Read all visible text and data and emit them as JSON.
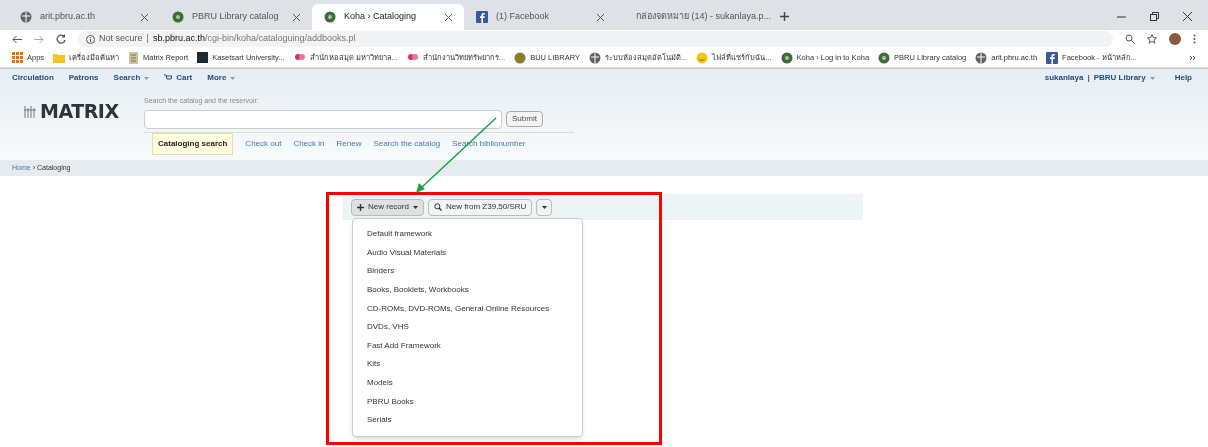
{
  "browser": {
    "tabs": [
      {
        "title": "arit.pbru.ac.th",
        "kind": "globe",
        "selected": false
      },
      {
        "title": "PBRU Library catalog",
        "kind": "koha",
        "selected": false
      },
      {
        "title": "Koha › Cataloging",
        "kind": "koha",
        "selected": true
      },
      {
        "title": "(1) Facebook",
        "kind": "facebook",
        "selected": false
      },
      {
        "title": "กล่องจดหมาย (14) - sukanlaya.p...",
        "kind": "gmail",
        "selected": false
      }
    ],
    "address": {
      "security": "Not secure",
      "separator": "|",
      "host": "sb.pbru.ac.th",
      "path": "/cgi-bin/koha/cataloguing/addbooks.pl"
    },
    "bookmarks": [
      {
        "label": "Apps",
        "kind": "apps"
      },
      {
        "label": "เครื่องมือค้นหา",
        "kind": "folder"
      },
      {
        "label": "Matrix Report",
        "kind": "doc"
      },
      {
        "label": "Kasetsart University...",
        "kind": "dark"
      },
      {
        "label": "สำนักหอสมุด มหาวิทยาล...",
        "kind": "pink"
      },
      {
        "label": "สำนักงานวิทยทรัพยากร...",
        "kind": "pink"
      },
      {
        "label": "BUU LIBRARY",
        "kind": "olive"
      },
      {
        "label": "ระบบห้องสมุดอัตโนมัติ...",
        "kind": "globe"
      },
      {
        "label": "ไฟล์ที่แชร์กับฉัน...",
        "kind": "smile"
      },
      {
        "label": "Koha › Log in to Koha",
        "kind": "koha"
      },
      {
        "label": "PBRU Library catalog",
        "kind": "koha"
      },
      {
        "label": "arit.pbru.ac.th",
        "kind": "globe"
      },
      {
        "label": "Facebook - หน้าหลัก...",
        "kind": "facebook"
      }
    ]
  },
  "koha": {
    "nav": [
      {
        "label": "Circulation",
        "dropdown": false
      },
      {
        "label": "Patrons",
        "dropdown": false
      },
      {
        "label": "Search",
        "dropdown": true
      },
      {
        "label": "Cart",
        "dropdown": false,
        "kind": "cart"
      },
      {
        "label": "More",
        "dropdown": true
      }
    ],
    "user": "sukanlaya",
    "user_separator": "|",
    "library": "PBRU Library",
    "help": "Help",
    "logo": "MATRIX",
    "search": {
      "label": "Search the catalog and the reservoir:",
      "submit": "Submit"
    },
    "search_tabs": [
      {
        "label": "Cataloging search",
        "selected": true
      },
      {
        "label": "Check out",
        "selected": false
      },
      {
        "label": "Check in",
        "selected": false
      },
      {
        "label": "Renew",
        "selected": false
      },
      {
        "label": "Search the catalog",
        "selected": false
      },
      {
        "label": "Search biblionumber",
        "selected": false
      }
    ],
    "breadcrumb": [
      "Home",
      "›",
      "Cataloging"
    ],
    "toolbar": {
      "new_record": "New record",
      "new_from": "New from Z39.50/SRU"
    },
    "frameworks": [
      "Default framework",
      "Audio Visual Materials",
      "Binders",
      "Books, Booklets, Workbooks",
      "CD-ROMs, DVD-ROMs, General Online Resources",
      "DVDs, VHS",
      "Fast Add Framework",
      "Kits",
      "Models",
      "PBRU Books",
      "Serials"
    ]
  }
}
